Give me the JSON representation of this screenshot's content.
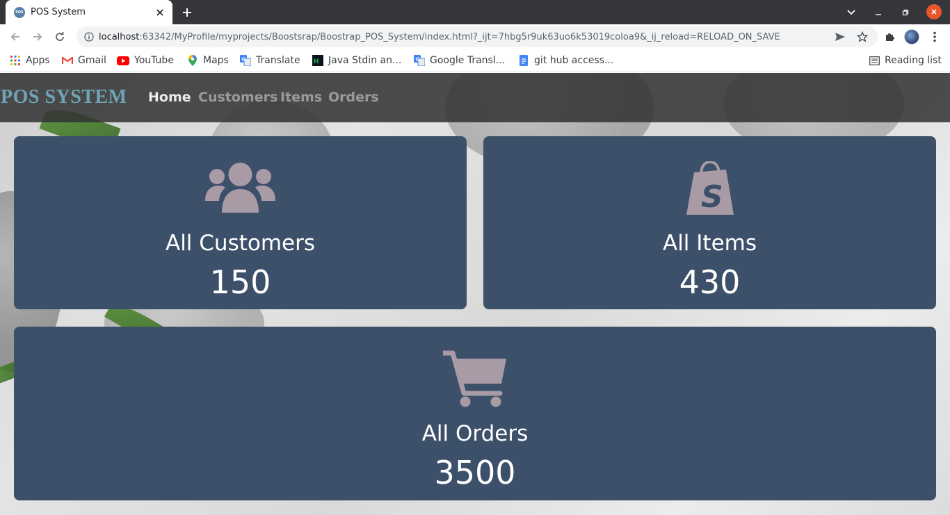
{
  "browser": {
    "tab_title": "POS System",
    "favicon_text": "POS",
    "url_host": "localhost",
    "url_rest": ":63342/MyProfile/myprojects/Boostsrap/Boostrap_POS_System/index.html?_ijt=7hbg5r9uk63uo6k53019coloa9&_ij_reload=RELOAD_ON_SAVE",
    "bookmarks": [
      {
        "label": "Apps",
        "icon": "apps-grid-icon"
      },
      {
        "label": "Gmail",
        "icon": "gmail-icon"
      },
      {
        "label": "YouTube",
        "icon": "youtube-icon"
      },
      {
        "label": "Maps",
        "icon": "maps-icon"
      },
      {
        "label": "Translate",
        "icon": "translate-icon"
      },
      {
        "label": "Java Stdin an...",
        "icon": "hackerrank-icon"
      },
      {
        "label": "Google Transl...",
        "icon": "translate-icon"
      },
      {
        "label": "git hub access...",
        "icon": "docs-icon"
      }
    ],
    "reading_list_label": "Reading list"
  },
  "app": {
    "brand": "POS SYSTEM",
    "nav": {
      "home": "Home",
      "customers": "Customers",
      "items": "Items",
      "orders": "Orders"
    },
    "cards": {
      "customers": {
        "title": "All Customers",
        "value": "150",
        "icon": "users-icon"
      },
      "items": {
        "title": "All Items",
        "value": "430",
        "icon": "shopping-bag-icon"
      },
      "orders": {
        "title": "All Orders",
        "value": "3500",
        "icon": "shopping-cart-icon"
      }
    }
  },
  "colors": {
    "navbar": "#323232",
    "brand": "#6fa4b6",
    "card": "#3d5069",
    "card_icon": "#a89ba6",
    "nav_active": "#eaeaea",
    "nav_inactive": "#9a9a9a"
  }
}
